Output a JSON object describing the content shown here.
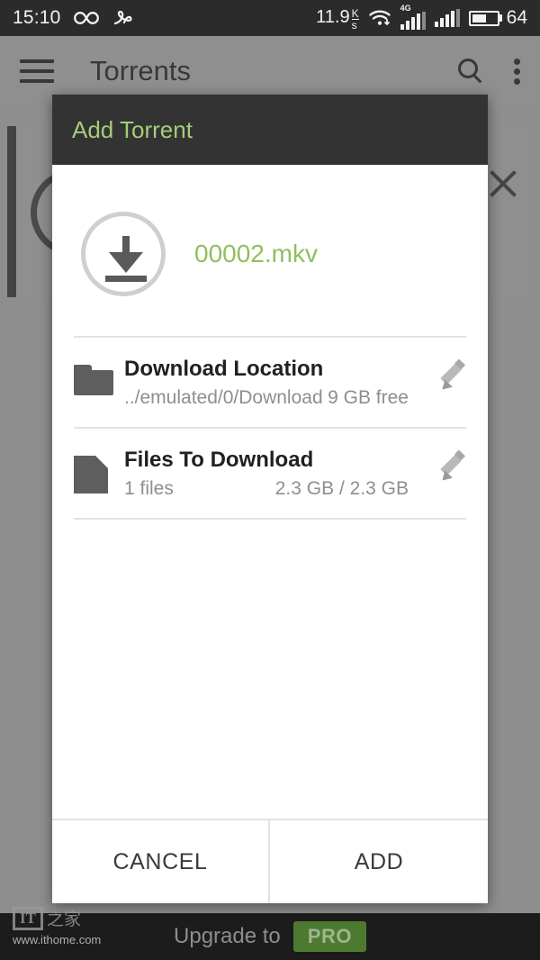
{
  "status_bar": {
    "time": "15:10",
    "icons": [
      "infinity-icon",
      "loop-alarm-icon"
    ],
    "network_rate": "11.9",
    "network_rate_unit_top": "K",
    "network_rate_unit_bottom": "s",
    "wifi": "wifi-download-icon",
    "mobile_network_label": "4G",
    "signal_1": "signal-bars-icon",
    "signal_2": "signal-bars-icon",
    "battery_level": "64"
  },
  "app_bar": {
    "menu_icon": "hamburger-icon",
    "title": "Torrents",
    "search_icon": "search-icon",
    "overflow_icon": "more-vertical-icon"
  },
  "dialog": {
    "title": "Add Torrent",
    "torrent_icon": "download-circle-icon",
    "filename": "00002.mkv",
    "rows": [
      {
        "icon": "folder-icon",
        "title": "Download Location",
        "subtitle": "../emulated/0/Download",
        "meta": "9 GB free",
        "edit_icon": "pencil-icon"
      },
      {
        "icon": "file-icon",
        "title": "Files To Download",
        "subtitle": "1 files",
        "meta": "2.3 GB / 2.3 GB",
        "edit_icon": "pencil-icon"
      }
    ],
    "cancel_label": "CANCEL",
    "add_label": "ADD"
  },
  "bottom_bar": {
    "upgrade_label": "Upgrade to",
    "pro_label": "PRO"
  },
  "watermark": {
    "logo_text": "IT",
    "logo_cn": "之家",
    "url": "www.ithome.com"
  },
  "colors": {
    "accent_green": "#8fbf5e",
    "title_green": "#a6cd7a",
    "dialog_header": "#333333",
    "status_bar": "#2b2b2b",
    "pro_badge": "#4d7a31",
    "scrim": "#4a4a4a"
  }
}
